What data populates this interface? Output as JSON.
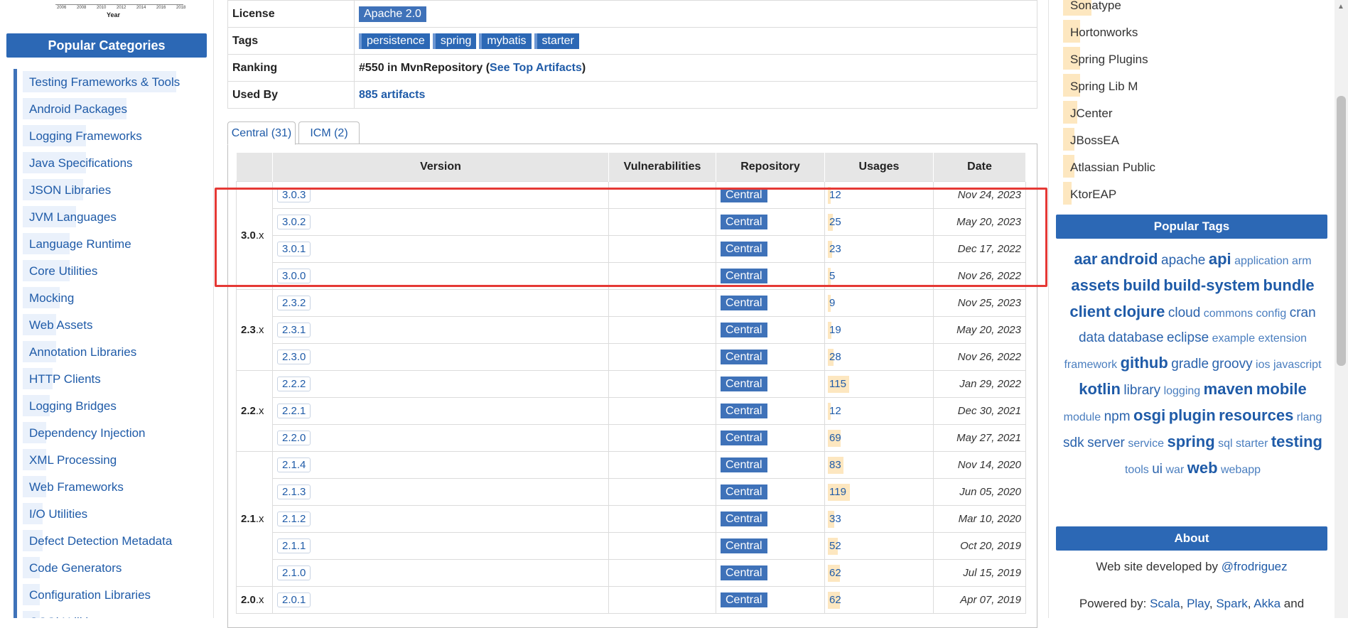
{
  "chart_stub": {
    "x_ticks": [
      "2006",
      "2008",
      "2010",
      "2012",
      "2014",
      "2016",
      "2018"
    ],
    "xlabel": "Year"
  },
  "left_sidebar": {
    "header": "Popular Categories",
    "items": [
      {
        "label": "Testing Frameworks & Tools",
        "bar": 0.92
      },
      {
        "label": "Android Packages",
        "bar": 0.62
      },
      {
        "label": "Logging Frameworks",
        "bar": 0.38
      },
      {
        "label": "Java Specifications",
        "bar": 0.38
      },
      {
        "label": "JSON Libraries",
        "bar": 0.36
      },
      {
        "label": "JVM Languages",
        "bar": 0.32
      },
      {
        "label": "Language Runtime",
        "bar": 0.28
      },
      {
        "label": "Core Utilities",
        "bar": 0.28
      },
      {
        "label": "Mocking",
        "bar": 0.22
      },
      {
        "label": "Web Assets",
        "bar": 0.2
      },
      {
        "label": "Annotation Libraries",
        "bar": 0.2
      },
      {
        "label": "HTTP Clients",
        "bar": 0.18
      },
      {
        "label": "Logging Bridges",
        "bar": 0.16
      },
      {
        "label": "Dependency Injection",
        "bar": 0.14
      },
      {
        "label": "XML Processing",
        "bar": 0.14
      },
      {
        "label": "Web Frameworks",
        "bar": 0.14
      },
      {
        "label": "I/O Utilities",
        "bar": 0.12
      },
      {
        "label": "Defect Detection Metadata",
        "bar": 0.12
      },
      {
        "label": "Code Generators",
        "bar": 0.1
      },
      {
        "label": "Configuration Libraries",
        "bar": 0.1
      },
      {
        "label": "OSGi Utilities",
        "bar": 0.1
      }
    ]
  },
  "info": {
    "license_key": "License",
    "license_value": "Apache 2.0",
    "tags_key": "Tags",
    "tags": [
      "persistence",
      "spring",
      "mybatis",
      "starter"
    ],
    "ranking_key": "Ranking",
    "ranking_prefix": "#550 in MvnRepository (",
    "ranking_link": "See Top Artifacts",
    "ranking_suffix": ")",
    "usedby_key": "Used By",
    "usedby_value": "885 artifacts"
  },
  "tabs": [
    {
      "label": "Central (31)",
      "active": true
    },
    {
      "label": "ICM (2)",
      "active": false
    }
  ],
  "versions_table": {
    "headers": [
      "Version",
      "Vulnerabilities",
      "Repository",
      "Usages",
      "Date"
    ],
    "groups": [
      {
        "major": "3.0",
        "suffix": ".x",
        "rows": [
          {
            "version": "3.0.3",
            "repo": "Central",
            "usages": "12",
            "usage_frac": 0.05,
            "date": "Nov 24, 2023"
          },
          {
            "version": "3.0.2",
            "repo": "Central",
            "usages": "25",
            "usage_frac": 0.09,
            "date": "May 20, 2023"
          },
          {
            "version": "3.0.1",
            "repo": "Central",
            "usages": "23",
            "usage_frac": 0.08,
            "date": "Dec 17, 2022"
          },
          {
            "version": "3.0.0",
            "repo": "Central",
            "usages": "5",
            "usage_frac": 0.03,
            "date": "Nov 26, 2022"
          }
        ]
      },
      {
        "major": "2.3",
        "suffix": ".x",
        "rows": [
          {
            "version": "2.3.2",
            "repo": "Central",
            "usages": "9",
            "usage_frac": 0.04,
            "date": "Nov 25, 2023"
          },
          {
            "version": "2.3.1",
            "repo": "Central",
            "usages": "19",
            "usage_frac": 0.07,
            "date": "May 20, 2023"
          },
          {
            "version": "2.3.0",
            "repo": "Central",
            "usages": "28",
            "usage_frac": 0.1,
            "date": "Nov 26, 2022"
          }
        ]
      },
      {
        "major": "2.2",
        "suffix": ".x",
        "rows": [
          {
            "version": "2.2.2",
            "repo": "Central",
            "usages": "115",
            "usage_frac": 0.4,
            "date": "Jan 29, 2022"
          },
          {
            "version": "2.2.1",
            "repo": "Central",
            "usages": "12",
            "usage_frac": 0.05,
            "date": "Dec 30, 2021"
          },
          {
            "version": "2.2.0",
            "repo": "Central",
            "usages": "69",
            "usage_frac": 0.24,
            "date": "May 27, 2021"
          }
        ]
      },
      {
        "major": "2.1",
        "suffix": ".x",
        "rows": [
          {
            "version": "2.1.4",
            "repo": "Central",
            "usages": "83",
            "usage_frac": 0.29,
            "date": "Nov 14, 2020"
          },
          {
            "version": "2.1.3",
            "repo": "Central",
            "usages": "119",
            "usage_frac": 0.41,
            "date": "Jun 05, 2020"
          },
          {
            "version": "2.1.2",
            "repo": "Central",
            "usages": "33",
            "usage_frac": 0.12,
            "date": "Mar 10, 2020"
          },
          {
            "version": "2.1.1",
            "repo": "Central",
            "usages": "52",
            "usage_frac": 0.18,
            "date": "Oct 20, 2019"
          },
          {
            "version": "2.1.0",
            "repo": "Central",
            "usages": "62",
            "usage_frac": 0.22,
            "date": "Jul 15, 2019"
          }
        ]
      },
      {
        "major": "2.0",
        "suffix": ".x",
        "rows": [
          {
            "version": "2.0.1",
            "repo": "Central",
            "usages": "62",
            "usage_frac": 0.22,
            "date": "Apr 07, 2019"
          }
        ]
      }
    ]
  },
  "right_sidebar": {
    "repositories": [
      {
        "label": "Sonatype",
        "bar": 0.2
      },
      {
        "label": "Hortonworks",
        "bar": 0.12
      },
      {
        "label": "Spring Plugins",
        "bar": 0.12
      },
      {
        "label": "Spring Lib M",
        "bar": 0.12
      },
      {
        "label": "JCenter",
        "bar": 0.1
      },
      {
        "label": "JBossEA",
        "bar": 0.08
      },
      {
        "label": "Atlassian Public",
        "bar": 0.08
      },
      {
        "label": "KtorEAP",
        "bar": 0.06
      }
    ],
    "tags_header": "Popular Tags",
    "tags": [
      {
        "t": "aar",
        "s": 3
      },
      {
        "t": "android",
        "s": 3
      },
      {
        "t": "apache",
        "s": 2
      },
      {
        "t": "api",
        "s": 3
      },
      {
        "t": "application",
        "s": 1
      },
      {
        "t": "arm",
        "s": 1
      },
      {
        "t": "assets",
        "s": 3
      },
      {
        "t": "build",
        "s": 3
      },
      {
        "t": "build-system",
        "s": 3
      },
      {
        "t": "bundle",
        "s": 3
      },
      {
        "t": "client",
        "s": 3
      },
      {
        "t": "clojure",
        "s": 3
      },
      {
        "t": "cloud",
        "s": 2
      },
      {
        "t": "commons",
        "s": 1
      },
      {
        "t": "config",
        "s": 1
      },
      {
        "t": "cran",
        "s": 2
      },
      {
        "t": "data",
        "s": 2
      },
      {
        "t": "database",
        "s": 2
      },
      {
        "t": "eclipse",
        "s": 2
      },
      {
        "t": "example",
        "s": 1
      },
      {
        "t": "extension",
        "s": 1
      },
      {
        "t": "framework",
        "s": 1
      },
      {
        "t": "github",
        "s": 3
      },
      {
        "t": "gradle",
        "s": 2
      },
      {
        "t": "groovy",
        "s": 2
      },
      {
        "t": "ios",
        "s": 1
      },
      {
        "t": "javascript",
        "s": 1
      },
      {
        "t": "kotlin",
        "s": 3
      },
      {
        "t": "library",
        "s": 2
      },
      {
        "t": "logging",
        "s": 1
      },
      {
        "t": "maven",
        "s": 3
      },
      {
        "t": "mobile",
        "s": 3
      },
      {
        "t": "module",
        "s": 1
      },
      {
        "t": "npm",
        "s": 2
      },
      {
        "t": "osgi",
        "s": 3
      },
      {
        "t": "plugin",
        "s": 3
      },
      {
        "t": "resources",
        "s": 3
      },
      {
        "t": "rlang",
        "s": 1
      },
      {
        "t": "sdk",
        "s": 2
      },
      {
        "t": "server",
        "s": 2
      },
      {
        "t": "service",
        "s": 1
      },
      {
        "t": "spring",
        "s": 3
      },
      {
        "t": "sql",
        "s": 1
      },
      {
        "t": "starter",
        "s": 1
      },
      {
        "t": "testing",
        "s": 3
      },
      {
        "t": "tools",
        "s": 1
      },
      {
        "t": "ui",
        "s": 2
      },
      {
        "t": "war",
        "s": 1
      },
      {
        "t": "web",
        "s": 3
      },
      {
        "t": "webapp",
        "s": 1
      }
    ],
    "about_header": "About",
    "about_prefix": "Web site developed by ",
    "about_link": "@frodriguez",
    "powered_prefix": "Powered by: ",
    "powered_links": [
      "Scala",
      "Play",
      "Spark",
      "Akka"
    ],
    "powered_suffix": " and"
  }
}
